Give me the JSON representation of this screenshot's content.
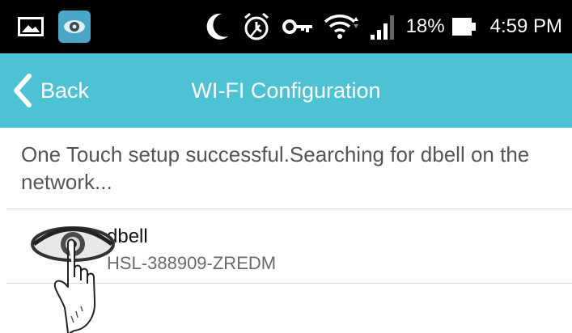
{
  "status_bar": {
    "battery_percent": "18%",
    "time": "4:59 PM",
    "icons": [
      "photo-notification-icon",
      "eye-app-notification-icon",
      "moon-icon",
      "alarm-icon",
      "key-icon",
      "wifi-icon",
      "signal-icon",
      "battery-icon"
    ]
  },
  "app_bar": {
    "back_label": "Back",
    "title": "WI-FI Configuration"
  },
  "message": "One Touch setup successful.Searching for dbell on the network...",
  "devices": [
    {
      "name": "dbell",
      "id": "HSL-388909-ZREDM",
      "icon": "eye-touch-icon"
    }
  ],
  "colors": {
    "status_bar": "#000000",
    "app_bar": "#4cc2d3",
    "text_primary": "#111111",
    "text_secondary": "#6a6a6a"
  }
}
